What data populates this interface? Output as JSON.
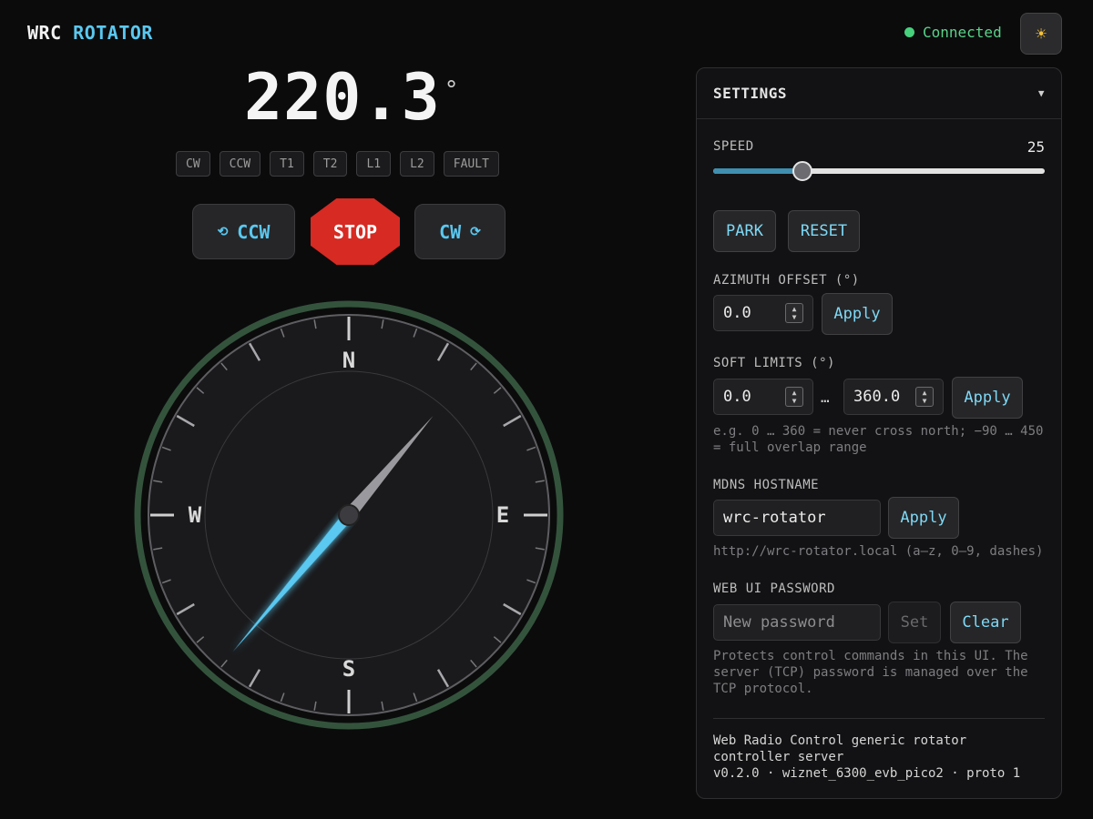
{
  "header": {
    "brand_part1": "WRC",
    "brand_part2": "ROTATOR",
    "status": "Connected",
    "status_color": "#47d17d",
    "theme_icon": "sun-icon",
    "theme_glyph": "☀"
  },
  "azimuth": {
    "value": "220.3",
    "unit": "°",
    "needle_deg": 220.3
  },
  "flags": [
    "CW",
    "CCW",
    "T1",
    "T2",
    "L1",
    "L2",
    "FAULT"
  ],
  "controls": {
    "ccw_label": "CCW",
    "stop_label": "STOP",
    "cw_label": "CW",
    "ccw_glyph": "⟲",
    "cw_glyph": "⟳"
  },
  "compass": {
    "north": "N",
    "east": "E",
    "south": "S",
    "west": "W"
  },
  "settings": {
    "title": "SETTINGS",
    "chevron": "▼",
    "speed": {
      "label": "SPEED",
      "value": "25",
      "fraction": 0.27
    },
    "park_label": "PARK",
    "reset_label": "RESET",
    "azimuth_offset": {
      "label": "AZIMUTH OFFSET (°)",
      "value": "0.0",
      "apply": "Apply"
    },
    "soft_limits": {
      "label": "SOFT LIMITS (°)",
      "min": "0.0",
      "separator": "…",
      "max": "360.0",
      "apply": "Apply",
      "hint": "e.g. 0 … 360 = never cross north; −90 … 450 = full overlap range"
    },
    "mdns": {
      "label": "MDNS HOSTNAME",
      "value": "wrc-rotator",
      "apply": "Apply",
      "hint": "http://wrc-rotator.local (a–z, 0–9, dashes)"
    },
    "password": {
      "label": "WEB UI PASSWORD",
      "placeholder": "New password",
      "set": "Set",
      "clear": "Clear",
      "hint": "Protects control commands in this UI. The server (TCP) password is managed over the TCP protocol."
    },
    "footer": {
      "line1": "Web Radio Control generic rotator controller server",
      "line2": "v0.2.0 · wiznet_6300_evb_pico2 · proto 1"
    }
  }
}
